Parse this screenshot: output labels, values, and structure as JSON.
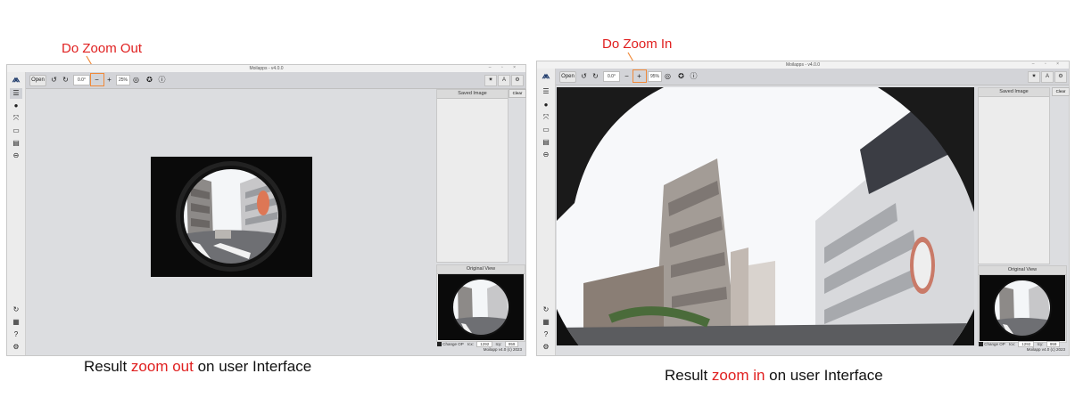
{
  "left": {
    "annotation": "Do Zoom Out",
    "caption": {
      "pre": "Result ",
      "highlight": "zoom out",
      "post": " on user Interface"
    },
    "window_title": "Moilapps - v4.0.0",
    "toolbar": {
      "open_label": "Open",
      "rotation_value": "0.0°",
      "zoom_minus": "−",
      "zoom_plus": "+",
      "zoom_value": "25%"
    },
    "saved_image_label": "Saved Image",
    "clear_label": "Clear",
    "original_view_label": "Original View",
    "change_op_label": "Change OP",
    "icx_label": "Icx:",
    "icx_value": "1292",
    "icy_label": "Icy:",
    "icy_value": "959",
    "version": "Moilapp v4.0 (c) 2023"
  },
  "right": {
    "annotation": "Do Zoom In",
    "caption": {
      "pre": "Result ",
      "highlight": "zoom in",
      "post": " on user Interface"
    },
    "window_title": "Moilapps - v4.0.0",
    "toolbar": {
      "open_label": "Open",
      "rotation_value": "0.0°",
      "zoom_minus": "−",
      "zoom_plus": "+",
      "zoom_value": "95%"
    },
    "saved_image_label": "Saved Image",
    "clear_label": "Clear",
    "original_view_label": "Original View",
    "change_op_label": "Change OP",
    "icx_label": "Icx:",
    "icx_value": "1292",
    "icy_label": "Icy:",
    "icy_value": "959",
    "version": "Moilapp v4.0 (c) 2023"
  },
  "icons": {
    "sidebar": [
      "menu-icon",
      "camera-icon",
      "crop-icon",
      "image-icon",
      "document-icon",
      "minus-circle-icon"
    ],
    "sidebar_bottom": [
      "refresh-icon",
      "log-icon",
      "help-icon",
      "settings-icon"
    ],
    "toolbar": [
      "rotate-left-icon",
      "rotate-right-icon",
      "zoom-out-icon",
      "zoom-in-icon",
      "fit-icon",
      "capture-icon",
      "info-icon"
    ],
    "toolbar_right": [
      "brightness-icon",
      "user-icon",
      "gear-icon"
    ]
  },
  "colors": {
    "accent": "#f08a3a",
    "annotation": "#e02020"
  }
}
